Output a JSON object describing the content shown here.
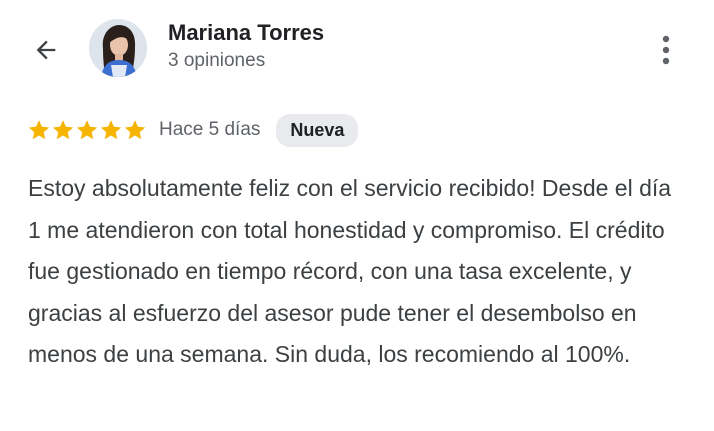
{
  "reviewer": {
    "name": "Mariana Torres",
    "reviews_count": "3 opiniones"
  },
  "review": {
    "rating": 5,
    "rating_max": 5,
    "time": "Hace 5 días",
    "badge": "Nueva",
    "text": "Estoy absolutamente feliz con el servicio recibido! Desde el día 1 me atendieron con total honestidad y compromiso. El crédito fue gestionado en tiempo récord, con una tasa excelente, y gracias al esfuerzo del asesor pude tener el desembolso en menos de una semana. Sin duda, los recomiendo al 100%."
  },
  "icons": {
    "back": "arrow-back-icon",
    "menu": "more-vert-icon",
    "star": "star-icon"
  },
  "colors": {
    "star": "#f4b400",
    "badge_bg": "#e8eaed",
    "secondary_text": "#5f6368",
    "body_text": "#3c4043"
  }
}
